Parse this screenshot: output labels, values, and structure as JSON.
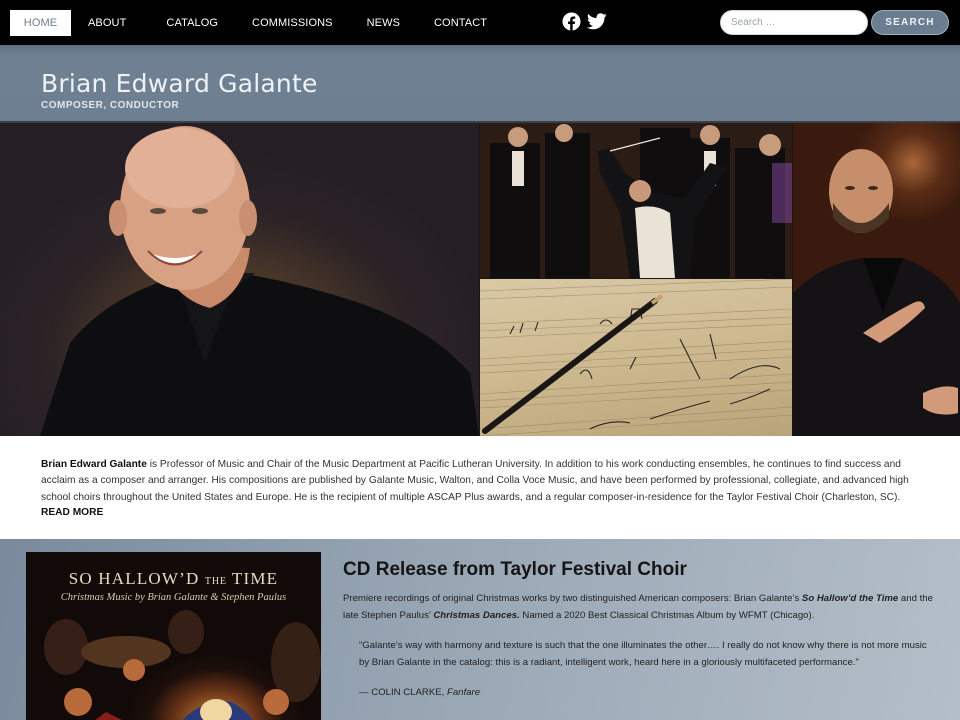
{
  "nav": {
    "items": [
      {
        "label": "HOME",
        "active": true
      },
      {
        "label": "ABOUT",
        "active": false
      },
      {
        "label": "CATALOG",
        "active": false
      },
      {
        "label": "COMMISSIONS",
        "active": false
      },
      {
        "label": "NEWS",
        "active": false
      },
      {
        "label": "CONTACT",
        "active": false
      }
    ],
    "social": [
      {
        "icon": "facebook-icon"
      },
      {
        "icon": "twitter-icon"
      }
    ],
    "search": {
      "placeholder": "Search …",
      "value": "",
      "button_label": "SEARCH"
    }
  },
  "header": {
    "title": "Brian Edward Galante",
    "tagline": "COMPOSER, CONDUCTOR"
  },
  "hero": {
    "images": [
      {
        "alt": "Portrait of Brian Edward Galante smiling in black shirt"
      },
      {
        "alt": "Conducting a choir and orchestra"
      },
      {
        "alt": "Handwritten music score with pencil"
      },
      {
        "alt": "Conducting gesture portrait"
      }
    ]
  },
  "intro": {
    "name": "Brian Edward Galante",
    "text": " is Professor of Music and Chair of the Music Department at Pacific Lutheran University. In addition to his work conducting ensembles, he continues to find success and acclaim as a composer and arranger. His compositions are published by Galante Music, Walton, and Colla Voce Music, and have been performed by professional, collegiate, and advanced high school choirs throughout the United States and Europe. He is the recipient of multiple ASCAP Plus awards, and a regular composer-in-residence for the Taylor Festival Choir (Charleston, SC).",
    "read_more": "READ MORE"
  },
  "feature": {
    "album": {
      "title_main": "SO HALLOW’D",
      "title_small": "THE",
      "title_end": "TIME",
      "subtitle": "Christmas Music by Brian Galante & Stephen Paulus"
    },
    "title": "CD Release from Taylor Festival Choir",
    "body_1": "Premiere recordings of original Christmas works by two distinguished American composers: Brian Galante’s ",
    "work_1": "So Hallow’d the Time",
    "body_2": " and the late Stephen Paulus’ ",
    "work_2": "Christmas Dances.",
    "body_3": " Named a 2020 Best Classical Christmas Album by WFMT (Chicago).",
    "quote": "“Galante’s way with harmony and texture is such that the one illuminates the other…. I really do not know why there is not more music by Brian Galante in the catalog: this is a radiant, intelligent work, heard here in a gloriously multifaceted performance.”",
    "cite_name": "— COLIN CLARKE, ",
    "cite_pub": "Fanfare"
  }
}
